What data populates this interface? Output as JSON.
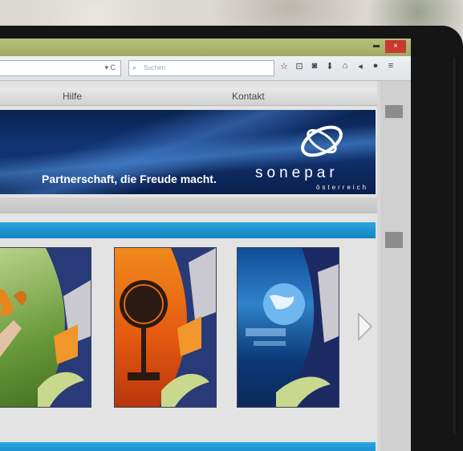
{
  "window": {
    "close_glyph": "×"
  },
  "toolbar": {
    "url_controls": "▾ C",
    "search_placeholder": "Suchen",
    "icons": [
      "star-icon",
      "lock-icon",
      "shield-icon",
      "download-icon",
      "home-icon",
      "send-icon",
      "chat-icon",
      "menu-icon"
    ]
  },
  "nav": {
    "items": [
      {
        "label": "Hilfe"
      },
      {
        "label": "Kontakt"
      }
    ]
  },
  "banner": {
    "tagline": "Partnerschaft, die Freude macht.",
    "brand_name": "sonepar",
    "brand_sub": "österreich"
  },
  "colors": {
    "accent_blue": "#1e96d2",
    "banner_navy": "#0f2d66",
    "chrome_green": "#a8b26a",
    "close_red": "#c8392f"
  }
}
